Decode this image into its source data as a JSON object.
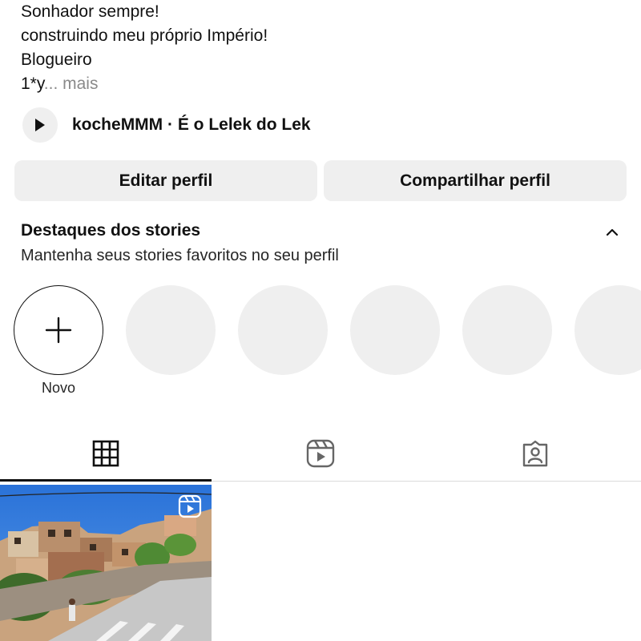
{
  "bio": {
    "line1": "Sonhador sempre!",
    "line2": "construindo meu próprio Império!",
    "line3": "Blogueiro",
    "line4_text": "1*y",
    "line4_more": "... mais"
  },
  "music": {
    "icon": "play-icon",
    "title": "kocheMMM · É o Lelek do Lek"
  },
  "buttons": {
    "edit": "Editar perfil",
    "share": "Compartilhar perfil"
  },
  "highlights": {
    "title": "Destaques dos stories",
    "subtitle": "Mantenha seus stories favoritos no seu perfil",
    "toggle_icon": "chevron-up-icon",
    "new_label": "Novo",
    "placeholder_count": 5
  },
  "tabs": [
    {
      "name": "grid",
      "icon": "grid-icon",
      "active": true
    },
    {
      "name": "reels",
      "icon": "reels-icon",
      "active": false
    },
    {
      "name": "tagged",
      "icon": "tagged-icon",
      "active": false
    }
  ],
  "posts": [
    {
      "type": "reel",
      "icon": "reel-icon"
    }
  ],
  "colors": {
    "button_bg": "#efefef",
    "placeholder_bg": "#efefef",
    "muted_text": "#8a8a8a",
    "divider": "#dbdbdb"
  }
}
